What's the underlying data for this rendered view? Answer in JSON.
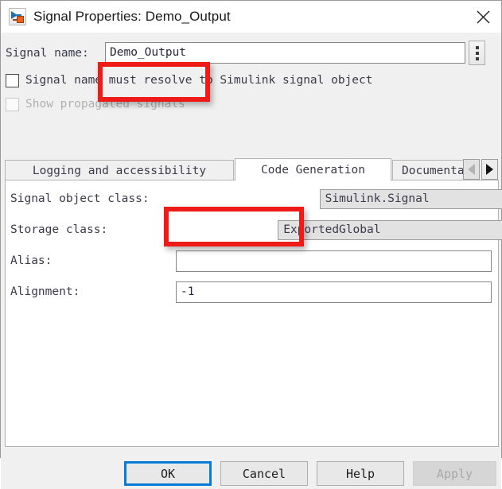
{
  "window": {
    "title": "Signal Properties: Demo_Output",
    "app_icon": "simulink-signal-icon",
    "close_icon": "close-icon"
  },
  "signal_name": {
    "label": "Signal name:",
    "value": "Demo_Output",
    "placeholder": "",
    "menu_icon": "vertical-ellipsis-icon"
  },
  "checkboxes": [
    {
      "label": "Signal name must resolve to Simulink signal object",
      "checked": false,
      "disabled": false
    },
    {
      "label": "Show propagated signals",
      "checked": false,
      "disabled": true
    }
  ],
  "tabs": {
    "items": [
      {
        "label": "Logging and accessibility",
        "selected": false
      },
      {
        "label": "Code Generation",
        "selected": true
      },
      {
        "label": "Documenta",
        "selected": false
      }
    ],
    "scroll_left_icon": "chevron-left-icon",
    "scroll_right_icon": "chevron-right-icon",
    "scroll_left_enabled": false,
    "scroll_right_enabled": true
  },
  "fields": [
    {
      "label": "Signal object class:",
      "control": "combo",
      "value": "Simulink.Signal",
      "caret_icon": "chevron-down-icon"
    },
    {
      "label": "Storage class:",
      "control": "combo",
      "value": "ExportedGlobal",
      "caret_icon": "chevron-down-icon"
    },
    {
      "label": "Alias:",
      "control": "text",
      "value": ""
    },
    {
      "label": "Alignment:",
      "control": "text",
      "value": "-1"
    }
  ],
  "buttons": [
    {
      "label": "OK",
      "state": "default-focused"
    },
    {
      "label": "Cancel",
      "state": "normal"
    },
    {
      "label": "Help",
      "state": "normal"
    },
    {
      "label": "Apply",
      "state": "disabled"
    }
  ],
  "annotations": {
    "color": "#ee1b18",
    "boxes": [
      {
        "target": "signal-name-input"
      },
      {
        "target": "storage-class-combo"
      }
    ]
  }
}
